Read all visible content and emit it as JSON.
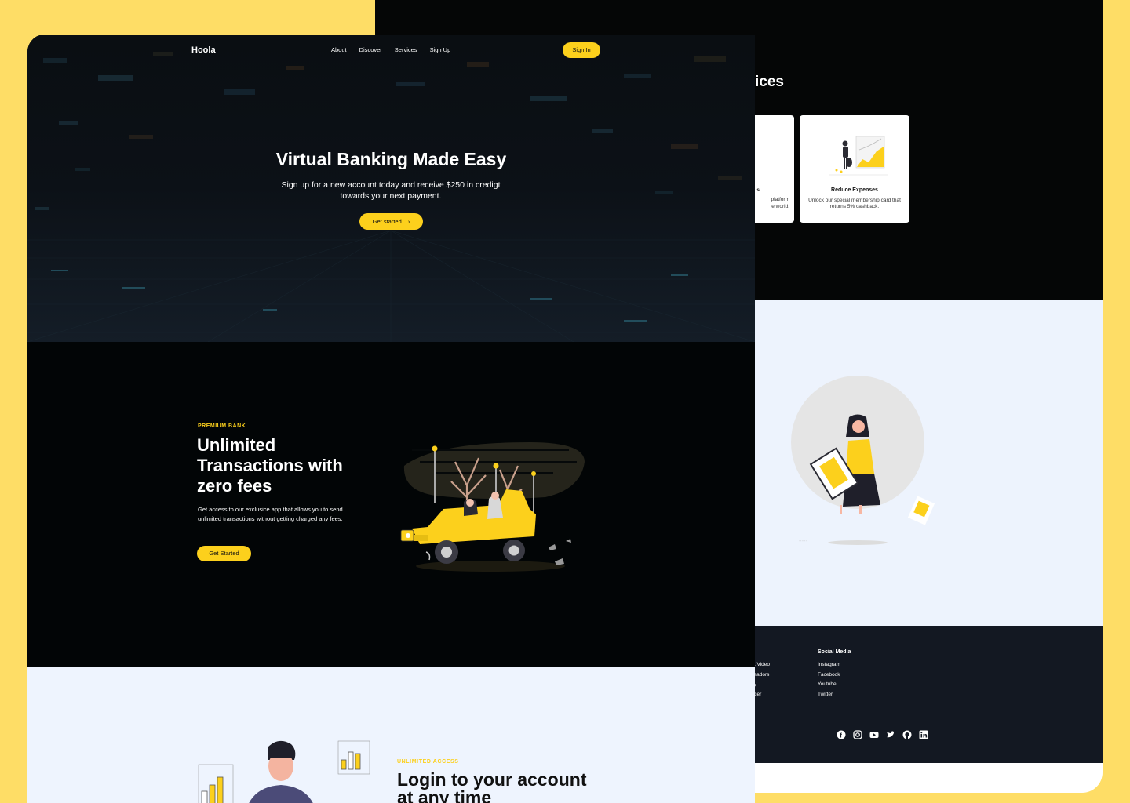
{
  "brand": {
    "yellow": "#fcd01c",
    "dark": "#020506",
    "light_bg": "#eef4fe",
    "page_bg": "#fedd66"
  },
  "back": {
    "services_title": "ices",
    "card1": {
      "title": "s",
      "text_line1": "platform",
      "text_line2": "e world."
    },
    "card2": {
      "title": "Reduce Expenses",
      "text": "Unlock our special membership card that returns 5% cashback."
    },
    "footer": {
      "col1": {
        "heading": "o",
        "items": [
          "mit Video",
          "assadors",
          "ncy",
          "encer"
        ]
      },
      "col2": {
        "heading": "Social Media",
        "items": [
          "Instagram",
          "Facebook",
          "Youtube",
          "Twitter"
        ]
      }
    },
    "social_icons": [
      "facebook-icon",
      "instagram-icon",
      "youtube-icon",
      "twitter-icon",
      "github-icon",
      "linkedin-icon"
    ]
  },
  "nav": {
    "logo": "Hoola",
    "links": [
      "About",
      "Discover",
      "Services",
      "Sign Up"
    ],
    "signin": "Sign In"
  },
  "hero": {
    "title": "Virtual Banking Made Easy",
    "subtitle": "Sign up for a new account today and receive $250 in credigt towards your next payment.",
    "button": "Get started",
    "button_icon": "chevron-right-icon"
  },
  "premium": {
    "label": "PREMIUM BANK",
    "title": "Unlimited Transactions with zero fees",
    "text": "Get access to our exclusice app that allows you to send unlimited transactions without getting charged any fees.",
    "button": "Get Started"
  },
  "access": {
    "label": "UNLIMITED ACCESS",
    "title": "Login to your account at any time"
  }
}
